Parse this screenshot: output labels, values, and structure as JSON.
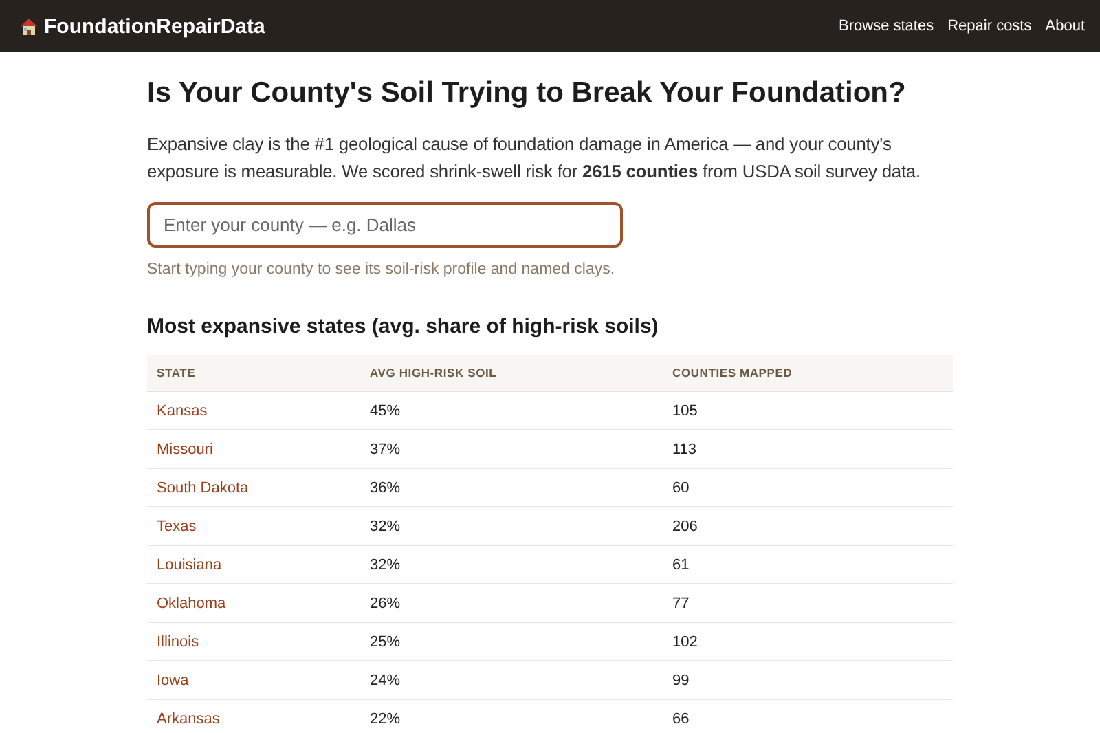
{
  "header": {
    "brand": "FoundationRepairData",
    "nav": [
      "Browse states",
      "Repair costs",
      "About"
    ]
  },
  "title": "Is Your County's Soil Trying to Break Your Foundation?",
  "intro": "Expansive clay is the #1 geological cause of foundation damage in America — and your county's exposure is measurable. We scored shrink-swell risk for **2615 counties** from USDA soil survey data.",
  "search": {
    "placeholder": "Enter your county — e.g. Dallas"
  },
  "hint": "Start typing your county to see its soil-risk profile and named clays.",
  "table": {
    "title": "Most expansive states (avg. share of high-risk soils)",
    "columns": [
      "STATE",
      "AVG HIGH-RISK SOIL",
      "COUNTIES MAPPED"
    ],
    "rows": [
      {
        "state": "Kansas",
        "avg": "45%",
        "counties": "105"
      },
      {
        "state": "Missouri",
        "avg": "37%",
        "counties": "113"
      },
      {
        "state": "South Dakota",
        "avg": "36%",
        "counties": "60"
      },
      {
        "state": "Texas",
        "avg": "32%",
        "counties": "206"
      },
      {
        "state": "Louisiana",
        "avg": "32%",
        "counties": "61"
      },
      {
        "state": "Oklahoma",
        "avg": "26%",
        "counties": "77"
      },
      {
        "state": "Illinois",
        "avg": "25%",
        "counties": "102"
      },
      {
        "state": "Iowa",
        "avg": "24%",
        "counties": "99"
      },
      {
        "state": "Arkansas",
        "avg": "22%",
        "counties": "66"
      }
    ]
  }
}
